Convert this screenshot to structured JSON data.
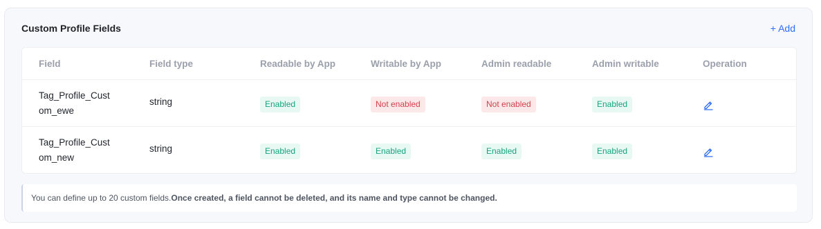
{
  "section": {
    "title": "Custom Profile Fields",
    "add_label": "+ Add"
  },
  "table": {
    "headers": [
      "Field",
      "Field type",
      "Readable by App",
      "Writable by App",
      "Admin readable",
      "Admin writable",
      "Operation"
    ],
    "rows": [
      {
        "field": "Tag_Profile_Custom_ewe",
        "type": "string",
        "readable_by_app": "Enabled",
        "writable_by_app": "Not enabled",
        "admin_readable": "Not enabled",
        "admin_writable": "Enabled",
        "operation_icon": "edit-icon"
      },
      {
        "field": "Tag_Profile_Custom_new",
        "type": "string",
        "readable_by_app": "Enabled",
        "writable_by_app": "Enabled",
        "admin_readable": "Enabled",
        "admin_writable": "Enabled",
        "operation_icon": "edit-icon"
      }
    ]
  },
  "notice": {
    "text": "You can define up to 20 custom fields.",
    "bold_text": "Once created, a field cannot be deleted, and its name and type cannot be changed."
  },
  "colors": {
    "accent": "#2f6df6",
    "enabled_text": "#16a37d",
    "enabled_bg": "#e8f8f2",
    "disabled_text": "#d0414b",
    "disabled_bg": "#fde8e9"
  }
}
